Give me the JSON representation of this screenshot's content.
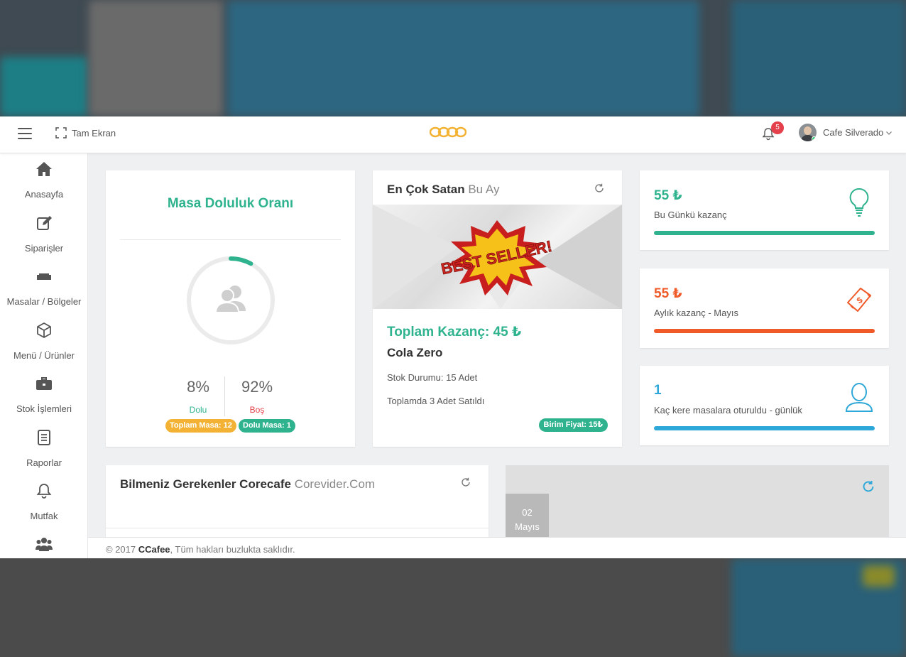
{
  "topbar": {
    "fullscreen_label": "Tam Ekran",
    "notification_count": "5",
    "user_name": "Cafe Silverado"
  },
  "sidebar": {
    "items": [
      {
        "label": "Anasayfa",
        "icon": "home-icon"
      },
      {
        "label": "Siparişler",
        "icon": "edit-icon"
      },
      {
        "label": "Masalar / Bölgeler",
        "icon": "sofa-icon"
      },
      {
        "label": "Menü / Ürünler",
        "icon": "cube-icon"
      },
      {
        "label": "Stok İşlemleri",
        "icon": "briefcase-icon"
      },
      {
        "label": "Raporlar",
        "icon": "document-icon"
      },
      {
        "label": "Mutfak",
        "icon": "bell-icon"
      },
      {
        "label": "",
        "icon": "users-icon"
      }
    ]
  },
  "occupancy": {
    "title": "Masa Doluluk Oranı",
    "full_pct": "8%",
    "full_label": "Dolu",
    "empty_pct": "92%",
    "empty_label": "Boş",
    "fill_fraction": 0.08,
    "total_tables": "Toplam Masa: 12",
    "occupied_tables": "Dolu Masa: 1"
  },
  "best_seller": {
    "title": "En Çok Satan",
    "subtitle": "Bu Ay",
    "banner_text": "BEST SELLER!",
    "total_earnings": "Toplam Kazanç: 45 ₺",
    "product_name": "Cola Zero",
    "stock": "Stok Durumu: 15 Adet",
    "sold": "Toplamda 3 Adet Satıldı",
    "unit_price": "Birim Fiyat: 15₺"
  },
  "stats": [
    {
      "value": "55 ₺",
      "label": "Bu Günkü kazanç",
      "color": "#2fb38e",
      "icon": "lightbulb-icon"
    },
    {
      "value": "55 ₺",
      "label": "Aylık kazanç - Mayıs",
      "color": "#f05a28",
      "icon": "money-icon"
    },
    {
      "value": "1",
      "label": "Kaç kere masalara oturuldu - günlük",
      "color": "#2ea8d8",
      "icon": "user-icon"
    }
  ],
  "info": {
    "title": "Bilmeniz Gerekenler Corecafe",
    "subtitle": "Corevider.Com"
  },
  "calendar": {
    "day": "02",
    "month": "Mayıs"
  },
  "footer": {
    "copyright": "© 2017",
    "brand": "CCafee",
    "rights": ", Tüm hakları buzlukta saklıdır."
  },
  "colors": {
    "green": "#2fb38e",
    "orange": "#f05a28",
    "blue": "#2ea8d8",
    "yellow": "#f3b233",
    "red": "#e5414c"
  }
}
